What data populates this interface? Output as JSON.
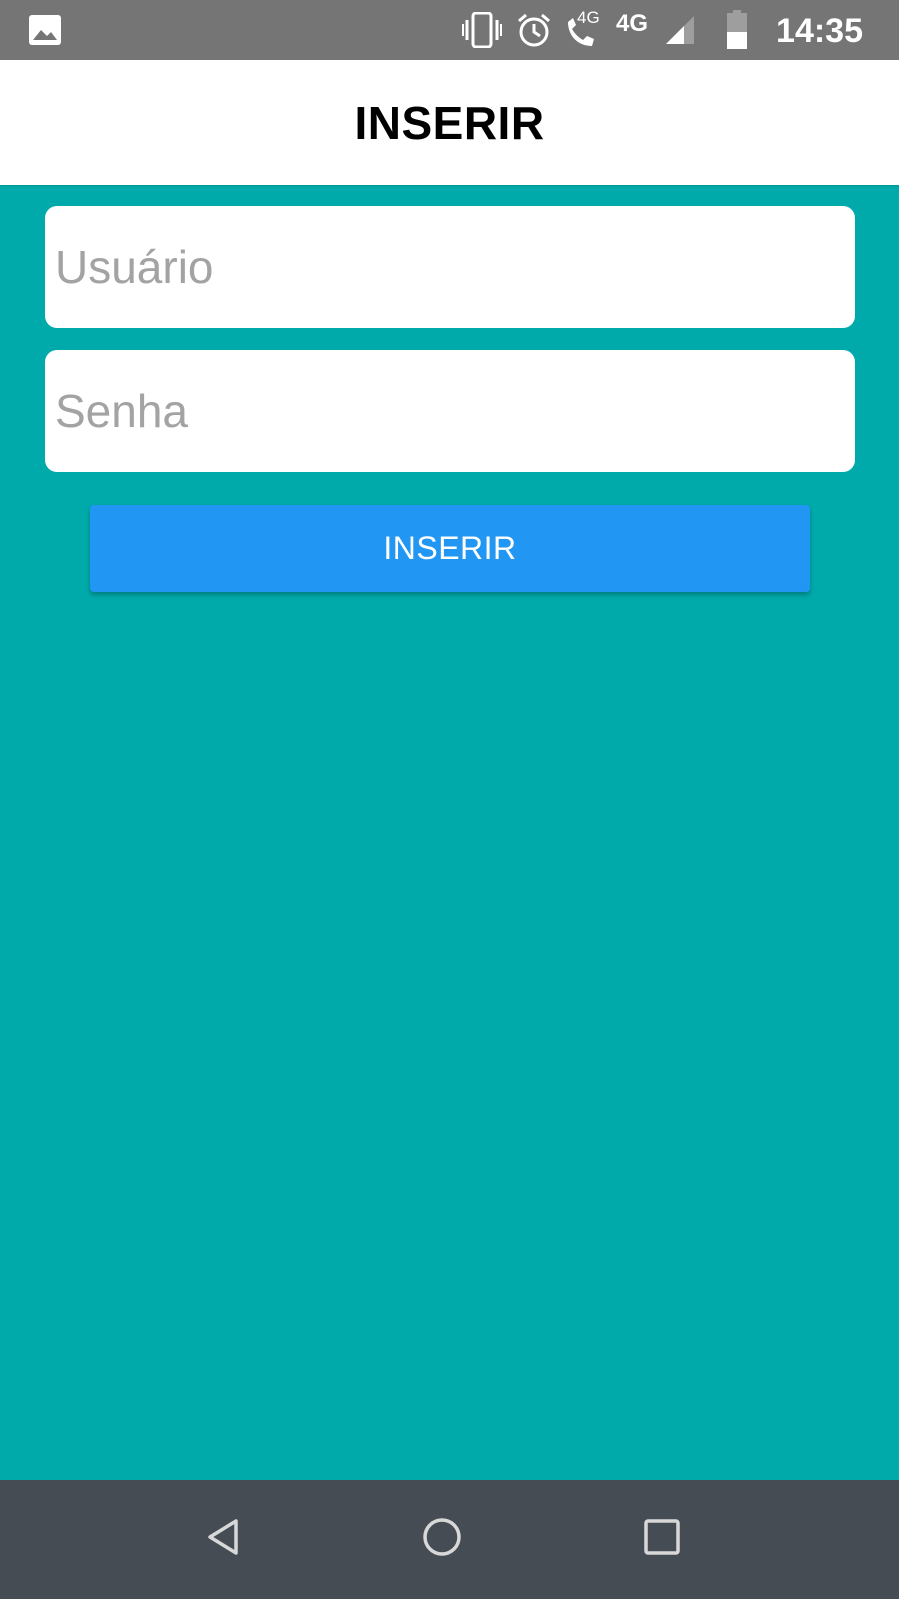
{
  "status_bar": {
    "time": "14:35",
    "network_call_label": "4G",
    "network_label": "4G",
    "icons": [
      "gallery-icon",
      "vibrate-icon",
      "alarm-icon",
      "phone-4g-icon",
      "signal-icon",
      "battery-icon"
    ],
    "background_color": "#757575"
  },
  "app_bar": {
    "title": "INSERIR"
  },
  "form": {
    "username_placeholder": "Usuário",
    "username_value": "",
    "password_placeholder": "Senha",
    "password_value": "",
    "submit_label": "INSERIR",
    "background_color": "#00aaaa",
    "button_color": "#2196f3"
  },
  "nav_bar": {
    "icons": [
      "back-icon",
      "home-icon",
      "recents-icon"
    ],
    "background_color": "#454c53"
  }
}
